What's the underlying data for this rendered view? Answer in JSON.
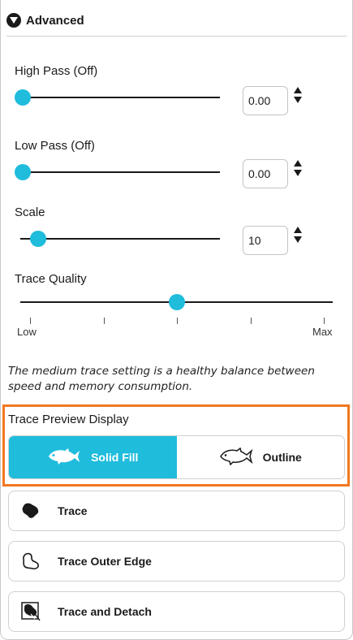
{
  "section": {
    "title": "Advanced"
  },
  "high_pass": {
    "label": "High Pass (Off)",
    "value": "0.00",
    "slider_fraction": 0.0
  },
  "low_pass": {
    "label": "Low Pass (Off)",
    "value": "0.00",
    "slider_fraction": 0.0
  },
  "scale": {
    "label": "Scale",
    "value": "10",
    "slider_fraction": 0.08
  },
  "trace_quality": {
    "label": "Trace Quality",
    "min_label": "Low",
    "max_label": "Max",
    "tick_count": 5,
    "slider_fraction": 0.5
  },
  "note": "The medium trace setting is a healthy balance between speed and memory consumption.",
  "trace_preview": {
    "label": "Trace Preview Display",
    "options": [
      {
        "label": "Solid Fill",
        "icon": "fish-solid-icon",
        "selected": true
      },
      {
        "label": "Outline",
        "icon": "fish-outline-icon",
        "selected": false
      }
    ]
  },
  "modes": [
    {
      "label": "Trace",
      "icon": "trace-blob-icon"
    },
    {
      "label": "Trace Outer Edge",
      "icon": "trace-outline-icon"
    },
    {
      "label": "Trace and Detach",
      "icon": "trace-detach-icon"
    }
  ],
  "colors": {
    "accent": "#1fbcdc",
    "highlight": "#f07822"
  }
}
